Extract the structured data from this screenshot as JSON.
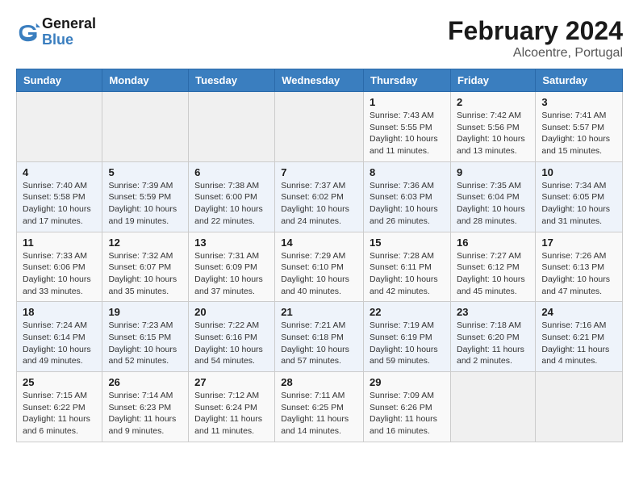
{
  "header": {
    "logo_line1": "General",
    "logo_line2": "Blue",
    "title": "February 2024",
    "subtitle": "Alcoentre, Portugal"
  },
  "calendar": {
    "days_of_week": [
      "Sunday",
      "Monday",
      "Tuesday",
      "Wednesday",
      "Thursday",
      "Friday",
      "Saturday"
    ],
    "weeks": [
      [
        {
          "day": "",
          "info": ""
        },
        {
          "day": "",
          "info": ""
        },
        {
          "day": "",
          "info": ""
        },
        {
          "day": "",
          "info": ""
        },
        {
          "day": "1",
          "info": "Sunrise: 7:43 AM\nSunset: 5:55 PM\nDaylight: 10 hours\nand 11 minutes."
        },
        {
          "day": "2",
          "info": "Sunrise: 7:42 AM\nSunset: 5:56 PM\nDaylight: 10 hours\nand 13 minutes."
        },
        {
          "day": "3",
          "info": "Sunrise: 7:41 AM\nSunset: 5:57 PM\nDaylight: 10 hours\nand 15 minutes."
        }
      ],
      [
        {
          "day": "4",
          "info": "Sunrise: 7:40 AM\nSunset: 5:58 PM\nDaylight: 10 hours\nand 17 minutes."
        },
        {
          "day": "5",
          "info": "Sunrise: 7:39 AM\nSunset: 5:59 PM\nDaylight: 10 hours\nand 19 minutes."
        },
        {
          "day": "6",
          "info": "Sunrise: 7:38 AM\nSunset: 6:00 PM\nDaylight: 10 hours\nand 22 minutes."
        },
        {
          "day": "7",
          "info": "Sunrise: 7:37 AM\nSunset: 6:02 PM\nDaylight: 10 hours\nand 24 minutes."
        },
        {
          "day": "8",
          "info": "Sunrise: 7:36 AM\nSunset: 6:03 PM\nDaylight: 10 hours\nand 26 minutes."
        },
        {
          "day": "9",
          "info": "Sunrise: 7:35 AM\nSunset: 6:04 PM\nDaylight: 10 hours\nand 28 minutes."
        },
        {
          "day": "10",
          "info": "Sunrise: 7:34 AM\nSunset: 6:05 PM\nDaylight: 10 hours\nand 31 minutes."
        }
      ],
      [
        {
          "day": "11",
          "info": "Sunrise: 7:33 AM\nSunset: 6:06 PM\nDaylight: 10 hours\nand 33 minutes."
        },
        {
          "day": "12",
          "info": "Sunrise: 7:32 AM\nSunset: 6:07 PM\nDaylight: 10 hours\nand 35 minutes."
        },
        {
          "day": "13",
          "info": "Sunrise: 7:31 AM\nSunset: 6:09 PM\nDaylight: 10 hours\nand 37 minutes."
        },
        {
          "day": "14",
          "info": "Sunrise: 7:29 AM\nSunset: 6:10 PM\nDaylight: 10 hours\nand 40 minutes."
        },
        {
          "day": "15",
          "info": "Sunrise: 7:28 AM\nSunset: 6:11 PM\nDaylight: 10 hours\nand 42 minutes."
        },
        {
          "day": "16",
          "info": "Sunrise: 7:27 AM\nSunset: 6:12 PM\nDaylight: 10 hours\nand 45 minutes."
        },
        {
          "day": "17",
          "info": "Sunrise: 7:26 AM\nSunset: 6:13 PM\nDaylight: 10 hours\nand 47 minutes."
        }
      ],
      [
        {
          "day": "18",
          "info": "Sunrise: 7:24 AM\nSunset: 6:14 PM\nDaylight: 10 hours\nand 49 minutes."
        },
        {
          "day": "19",
          "info": "Sunrise: 7:23 AM\nSunset: 6:15 PM\nDaylight: 10 hours\nand 52 minutes."
        },
        {
          "day": "20",
          "info": "Sunrise: 7:22 AM\nSunset: 6:16 PM\nDaylight: 10 hours\nand 54 minutes."
        },
        {
          "day": "21",
          "info": "Sunrise: 7:21 AM\nSunset: 6:18 PM\nDaylight: 10 hours\nand 57 minutes."
        },
        {
          "day": "22",
          "info": "Sunrise: 7:19 AM\nSunset: 6:19 PM\nDaylight: 10 hours\nand 59 minutes."
        },
        {
          "day": "23",
          "info": "Sunrise: 7:18 AM\nSunset: 6:20 PM\nDaylight: 11 hours\nand 2 minutes."
        },
        {
          "day": "24",
          "info": "Sunrise: 7:16 AM\nSunset: 6:21 PM\nDaylight: 11 hours\nand 4 minutes."
        }
      ],
      [
        {
          "day": "25",
          "info": "Sunrise: 7:15 AM\nSunset: 6:22 PM\nDaylight: 11 hours\nand 6 minutes."
        },
        {
          "day": "26",
          "info": "Sunrise: 7:14 AM\nSunset: 6:23 PM\nDaylight: 11 hours\nand 9 minutes."
        },
        {
          "day": "27",
          "info": "Sunrise: 7:12 AM\nSunset: 6:24 PM\nDaylight: 11 hours\nand 11 minutes."
        },
        {
          "day": "28",
          "info": "Sunrise: 7:11 AM\nSunset: 6:25 PM\nDaylight: 11 hours\nand 14 minutes."
        },
        {
          "day": "29",
          "info": "Sunrise: 7:09 AM\nSunset: 6:26 PM\nDaylight: 11 hours\nand 16 minutes."
        },
        {
          "day": "",
          "info": ""
        },
        {
          "day": "",
          "info": ""
        }
      ]
    ]
  }
}
